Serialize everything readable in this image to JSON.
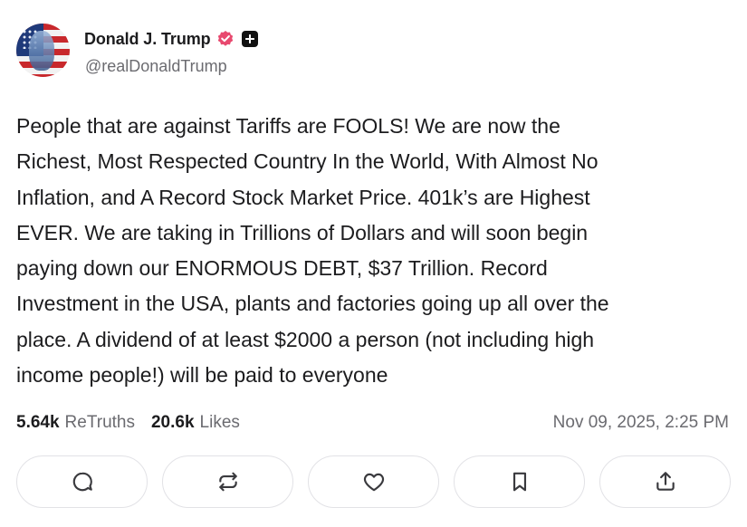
{
  "author": {
    "display_name": "Donald J. Trump",
    "handle": "@realDonaldTrump",
    "verified_color": "#e8496f"
  },
  "post": {
    "text": "People that are against Tariffs are FOOLS! We are now the\nRichest, Most Respected Country In the World, With Almost No\nInflation, and A Record Stock Market Price. 401k’s are Highest\nEVER. We are taking in Trillions of Dollars and will soon begin\npaying down our ENORMOUS DEBT, $37 Trillion. Record\nInvestment in the USA, plants and factories going up all over the\nplace. A dividend of at least $2000 a person (not including high\nincome people!) will be paid to everyone",
    "timestamp": "Nov 09, 2025, 2:25 PM"
  },
  "stats": {
    "retruths_count": "5.64k",
    "retruths_label": "ReTruths",
    "likes_count": "20.6k",
    "likes_label": "Likes"
  },
  "actions": [
    {
      "icon": "reply-icon"
    },
    {
      "icon": "retruth-icon"
    },
    {
      "icon": "like-icon"
    },
    {
      "icon": "bookmark-icon"
    },
    {
      "icon": "share-icon"
    }
  ]
}
